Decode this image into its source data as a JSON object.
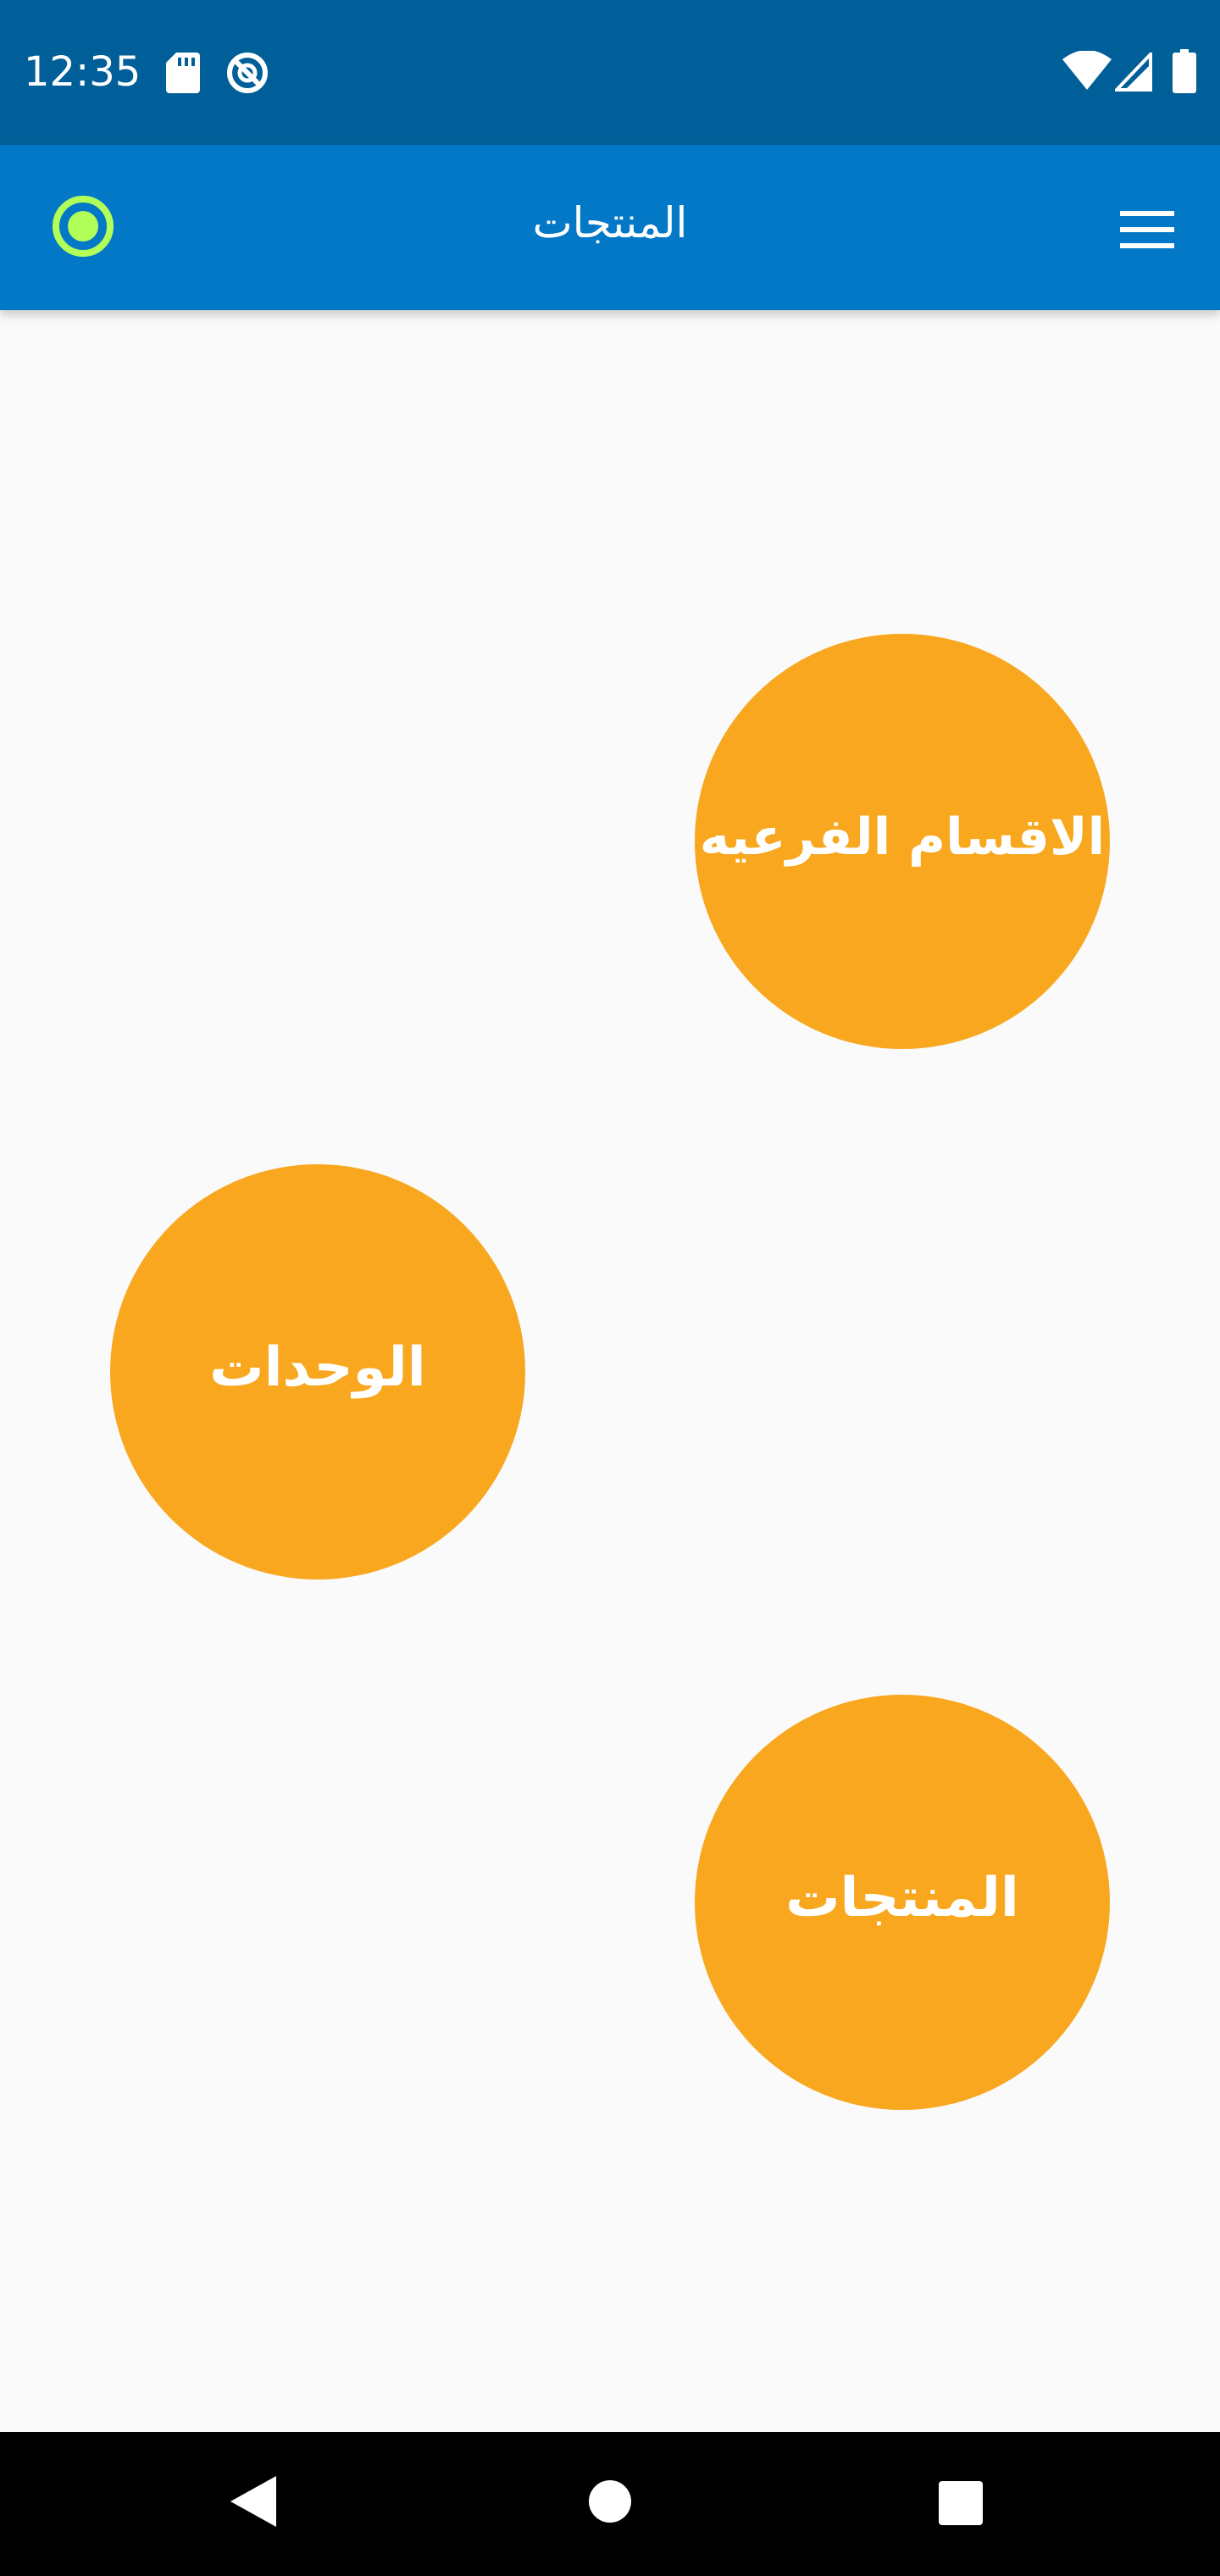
{
  "status_bar": {
    "time": "12:35",
    "icons": [
      "sd-card-icon",
      "sync-disabled-icon",
      "wifi-icon",
      "signal-icon",
      "battery-icon"
    ]
  },
  "app_bar": {
    "title": "المنتجات",
    "left_icon": "target-icon",
    "right_icon": "menu-icon",
    "background": "#0378c6",
    "indicator_color": "#b2ff59"
  },
  "main": {
    "background": "#fafafa",
    "button_color": "#f8a71e",
    "buttons": [
      {
        "label": "الاقسام الفرعيه"
      },
      {
        "label": "الوحدات"
      },
      {
        "label": "المنتجات"
      }
    ]
  },
  "nav_bar": {
    "icons": [
      "back-icon",
      "home-icon",
      "recents-icon"
    ]
  }
}
